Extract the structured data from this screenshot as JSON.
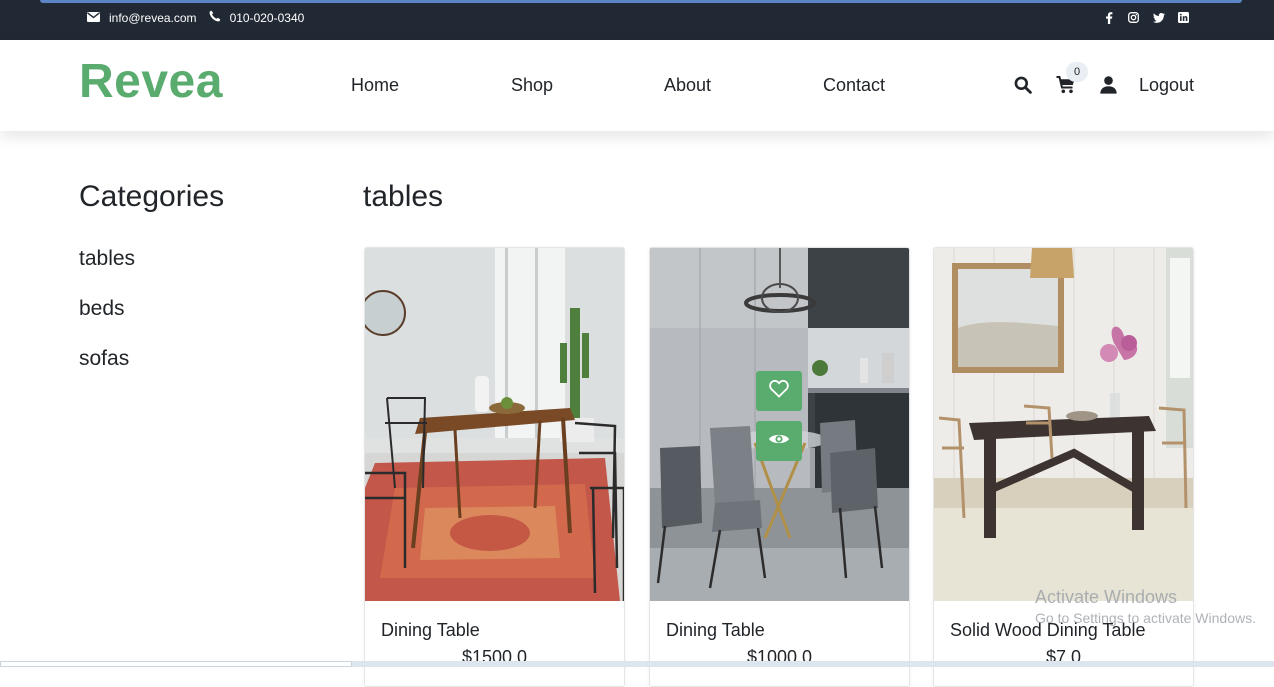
{
  "topbar": {
    "email": "info@revea.com",
    "phone": "010-020-0340",
    "social_icons": [
      "facebook-icon",
      "instagram-icon",
      "twitter-icon",
      "linkedin-icon"
    ]
  },
  "header": {
    "brand": "Revea",
    "nav": [
      "Home",
      "Shop",
      "About",
      "Contact"
    ],
    "cart_count": "0",
    "logout_label": "Logout"
  },
  "sidebar": {
    "title": "Categories",
    "categories": [
      "tables",
      "beds",
      "sofas"
    ]
  },
  "main": {
    "section_title": "tables",
    "products": [
      {
        "name": "Dining Table",
        "price": "$1500.0"
      },
      {
        "name": "Dining Table",
        "price": "$1000.0"
      },
      {
        "name": "Solid Wood Dining Table",
        "price": "$7.0"
      }
    ]
  },
  "watermark": {
    "line1": "Activate Windows",
    "line2": "Go to Settings to activate Windows."
  },
  "colors": {
    "brand": "#59ab6e",
    "topbar_bg": "#212934"
  }
}
